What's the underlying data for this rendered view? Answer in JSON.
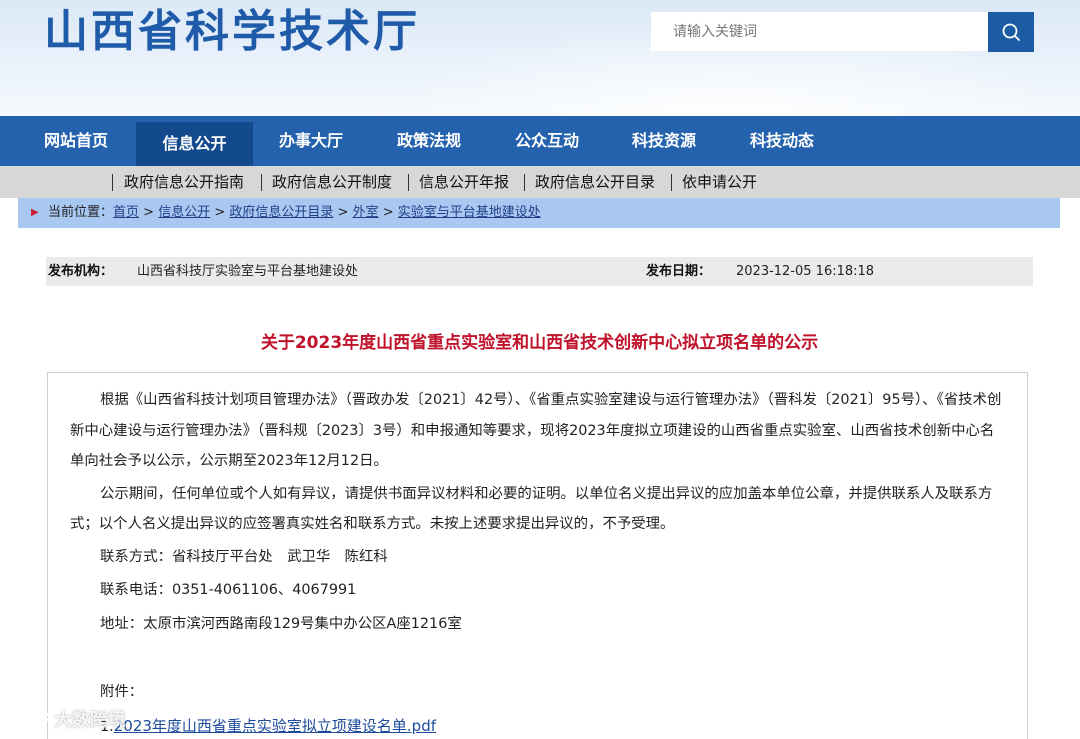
{
  "header": {
    "site_title": "山西省科学技术厅",
    "search_placeholder": "请输入关键词"
  },
  "nav": {
    "items": [
      {
        "label": "网站首页",
        "active": false
      },
      {
        "label": "信息公开",
        "active": true
      },
      {
        "label": "办事大厅",
        "active": false
      },
      {
        "label": "政策法规",
        "active": false
      },
      {
        "label": "公众互动",
        "active": false
      },
      {
        "label": "科技资源",
        "active": false
      },
      {
        "label": "科技动态",
        "active": false
      }
    ]
  },
  "subnav": {
    "items": [
      "政府信息公开指南",
      "政府信息公开制度",
      "信息公开年报",
      "政府信息公开目录",
      "依申请公开"
    ]
  },
  "breadcrumb": {
    "prefix": "当前位置：",
    "items": [
      "首页",
      "信息公开",
      "政府信息公开目录",
      "外室",
      "实验室与平台基地建设处"
    ],
    "separator": " > "
  },
  "meta": {
    "publisher_label": "发布机构：",
    "publisher_value": "山西省科技厅实验室与平台基地建设处",
    "date_label": "发布日期：",
    "date_value": "2023-12-05 16:18:18"
  },
  "article": {
    "title": "关于2023年度山西省重点实验室和山西省技术创新中心拟立项名单的公示",
    "para1": "根据《山西省科技计划项目管理办法》（晋政办发〔2021〕42号）、《省重点实验室建设与运行管理办法》（晋科发〔2021〕95号）、《省技术创新中心建设与运行管理办法》（晋科规〔2023〕3号）和申报通知等要求，现将2023年度拟立项建设的山西省重点实验室、山西省技术创新中心名单向社会予以公示，公示期至2023年12月12日。",
    "para2": "公示期间，任何单位或个人如有异议，请提供书面异议材料和必要的证明。以单位名义提出异议的应加盖本单位公章，并提供联系人及联系方式；以个人名义提出异议的应签署真实姓名和联系方式。未按上述要求提出异议的，不予受理。",
    "contact": "联系方式：省科技厅平台处　武卫华　陈红科",
    "phone": "联系电话：0351-4061106、4067991",
    "address": "地址：太原市滨河西路南段129号集中办公区A座1216室",
    "attachment_label": "附件：",
    "attachment_prefix": "1.",
    "attachment_link": "2023年度山西省重点实验室拟立项建设名单.pdf"
  },
  "watermark": "大数跨境",
  "colors": {
    "nav_bg": "#2462ad",
    "nav_active": "#134a8e",
    "breadcrumb_bg": "#a9c8f1",
    "title_red": "#c0132b",
    "brand_blue": "#1f5ba8"
  }
}
